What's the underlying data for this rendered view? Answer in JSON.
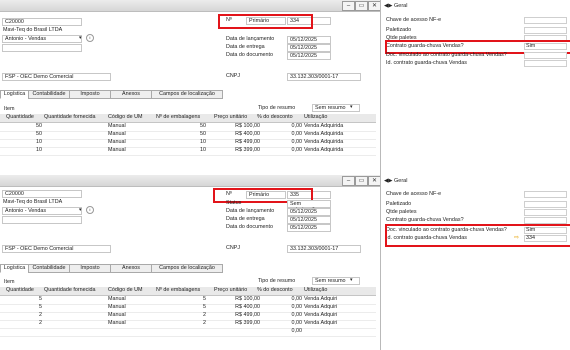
{
  "panes": [
    {
      "business_partner": {
        "code": "C20000",
        "name": "Mavi-Teq do Brasil LTDA",
        "contact": "Antonio - Vendas"
      },
      "branch": "FSP - OEC Demo Comercial",
      "number": {
        "label": "Nº",
        "series": "Primário",
        "value": "334"
      },
      "status_row": null,
      "dates": [
        {
          "label": "Data de lançamento",
          "value": "05/12/2025"
        },
        {
          "label": "Data de entrega",
          "value": "05/12/2025"
        },
        {
          "label": "Data do documento",
          "value": "05/12/2025"
        }
      ],
      "cnpj": {
        "label": "CNPJ",
        "value": "33.132.303/0001-17"
      },
      "tabs": [
        "Logística",
        "Contabilidade",
        "Imposto",
        "Anexos",
        "Campos de localização"
      ],
      "summary": {
        "label": "Tipo de resumo",
        "value": "Sem resumo"
      },
      "grid": {
        "item_label": "Item",
        "columns": [
          "Quantidade",
          "Quantidade fornecida",
          "Código de UM",
          "Nº de embalagens",
          "Preço unitário",
          "% do desconto",
          "Utilização"
        ],
        "rows": [
          {
            "qty": "",
            "delivered": "50",
            "uom": "Manual",
            "packs": "50",
            "price": "R$ 100,00",
            "disc": "0,00",
            "usage": "Venda Adquirida"
          },
          {
            "qty": "",
            "delivered": "50",
            "uom": "Manual",
            "packs": "50",
            "price": "R$ 400,00",
            "disc": "0,00",
            "usage": "Venda Adquirida"
          },
          {
            "qty": "",
            "delivered": "10",
            "uom": "Manual",
            "packs": "10",
            "price": "R$ 499,00",
            "disc": "0,00",
            "usage": "Venda Adquirida"
          },
          {
            "qty": "",
            "delivered": "10",
            "uom": "Manual",
            "packs": "10",
            "price": "R$ 399,00",
            "disc": "0,00",
            "usage": "Venda Adquirida"
          }
        ]
      },
      "right_panel": {
        "section": "Geral",
        "fields": [
          {
            "label": "Chave de acesso NF-e",
            "value": ""
          },
          {
            "label": "Paletizado",
            "value": ""
          },
          {
            "label": "Qtde paletes",
            "value": ""
          },
          {
            "label": "Contrato guarda-chuva Vendas?",
            "value": "Sim"
          },
          {
            "label": "Doc. vinculado ao contrato guarda-chuva Vendas?",
            "value": ""
          },
          {
            "label": "Id. contrato guarda-chuva Vendas",
            "value": ""
          }
        ]
      }
    },
    {
      "business_partner": {
        "code": "C20000",
        "name": "Mavi-Teq do Brasil LTDA",
        "contact": "Antonio - Vendas"
      },
      "branch": "FSP - OEC Demo Comercial",
      "number": {
        "label": "Nº",
        "series": "Primário",
        "value": "335"
      },
      "status_row": {
        "label": "Status",
        "value": "Sem autorização"
      },
      "dates": [
        {
          "label": "Data de lançamento",
          "value": "05/12/2025"
        },
        {
          "label": "Data de entrega",
          "value": "05/12/2025"
        },
        {
          "label": "Data do documento",
          "value": "05/12/2025"
        }
      ],
      "cnpj": {
        "label": "CNPJ",
        "value": "33.132.303/0001-17"
      },
      "tabs": [
        "Logística",
        "Contabilidade",
        "Imposto",
        "Anexos",
        "Campos de localização"
      ],
      "summary": {
        "label": "Tipo de resumo",
        "value": "Sem resumo"
      },
      "grid": {
        "item_label": "Item",
        "columns": [
          "Quantidade",
          "Quantidade fornecida",
          "Código de UM",
          "Nº de embalagens",
          "Preço unitário",
          "% do desconto",
          "Utilização"
        ],
        "rows": [
          {
            "qty": "5",
            "delivered": "",
            "uom": "Manual",
            "packs": "5",
            "price": "R$ 100,00",
            "disc": "0,00",
            "usage": "Venda Adquiri"
          },
          {
            "qty": "5",
            "delivered": "",
            "uom": "Manual",
            "packs": "5",
            "price": "R$ 400,00",
            "disc": "0,00",
            "usage": "Venda Adquiri"
          },
          {
            "qty": "2",
            "delivered": "",
            "uom": "Manual",
            "packs": "2",
            "price": "R$ 499,00",
            "disc": "0,00",
            "usage": "Venda Adquiri"
          },
          {
            "qty": "2",
            "delivered": "",
            "uom": "Manual",
            "packs": "2",
            "price": "R$ 399,00",
            "disc": "0,00",
            "usage": "Venda Adquiri"
          }
        ],
        "total": "0,00"
      },
      "right_panel": {
        "section": "Geral",
        "fields": [
          {
            "label": "Chave de acesso NF-e",
            "value": ""
          },
          {
            "label": "Paletizado",
            "value": ""
          },
          {
            "label": "Qtde paletes",
            "value": ""
          },
          {
            "label": "Contrato guarda-chuva Vendas?",
            "value": ""
          },
          {
            "label": "Doc. vinculado ao contrato guarda-chuva Vendas?",
            "value": "Sim"
          },
          {
            "label": "Id. contrato guarda-chuva Vendas",
            "value": "334"
          }
        ]
      }
    }
  ],
  "colors": {
    "highlight": "#e2141a",
    "link_arrow": "#e6a200"
  }
}
